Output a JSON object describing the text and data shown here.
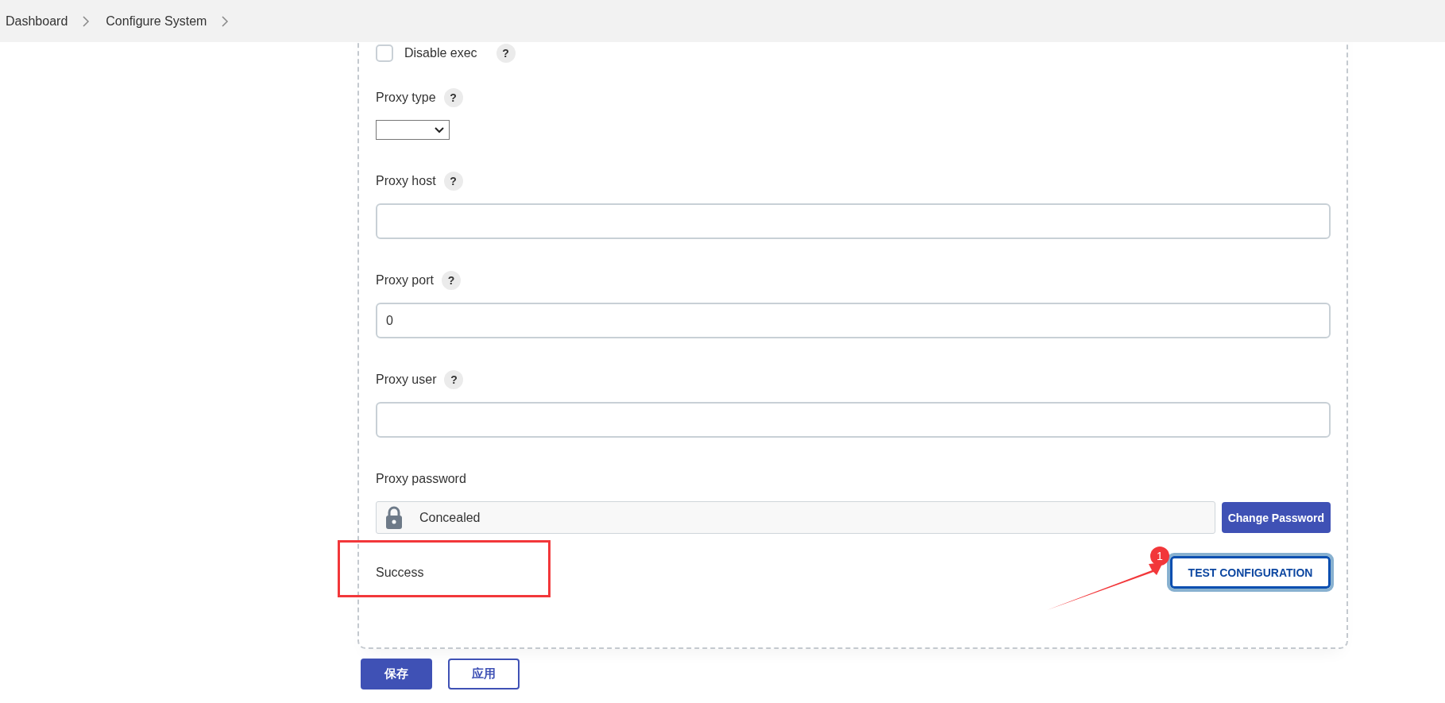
{
  "breadcrumb": [
    {
      "label": "Dashboard"
    },
    {
      "label": "Configure System"
    }
  ],
  "fields": [
    {
      "kind": "checkbox",
      "label": "Disable exec",
      "help": "?",
      "checked": false
    },
    {
      "kind": "select",
      "label": "Proxy type",
      "help": "?"
    },
    {
      "kind": "text",
      "label": "Proxy host",
      "help": "?"
    },
    {
      "kind": "text",
      "label": "Proxy port",
      "help": "?",
      "value": "0"
    },
    {
      "kind": "text",
      "label": "Proxy user",
      "help": "?"
    },
    {
      "kind": "password",
      "label": "Proxy password",
      "value": "Concealed",
      "button": "Change Password"
    }
  ],
  "test": {
    "result": "Success",
    "button": "TEST CONFIGURATION"
  },
  "annotation": {
    "badge": "1"
  },
  "footer": {
    "buttons": [
      {
        "label": "保存",
        "kind": "primary"
      },
      {
        "label": "应用",
        "kind": "secondary"
      }
    ]
  }
}
